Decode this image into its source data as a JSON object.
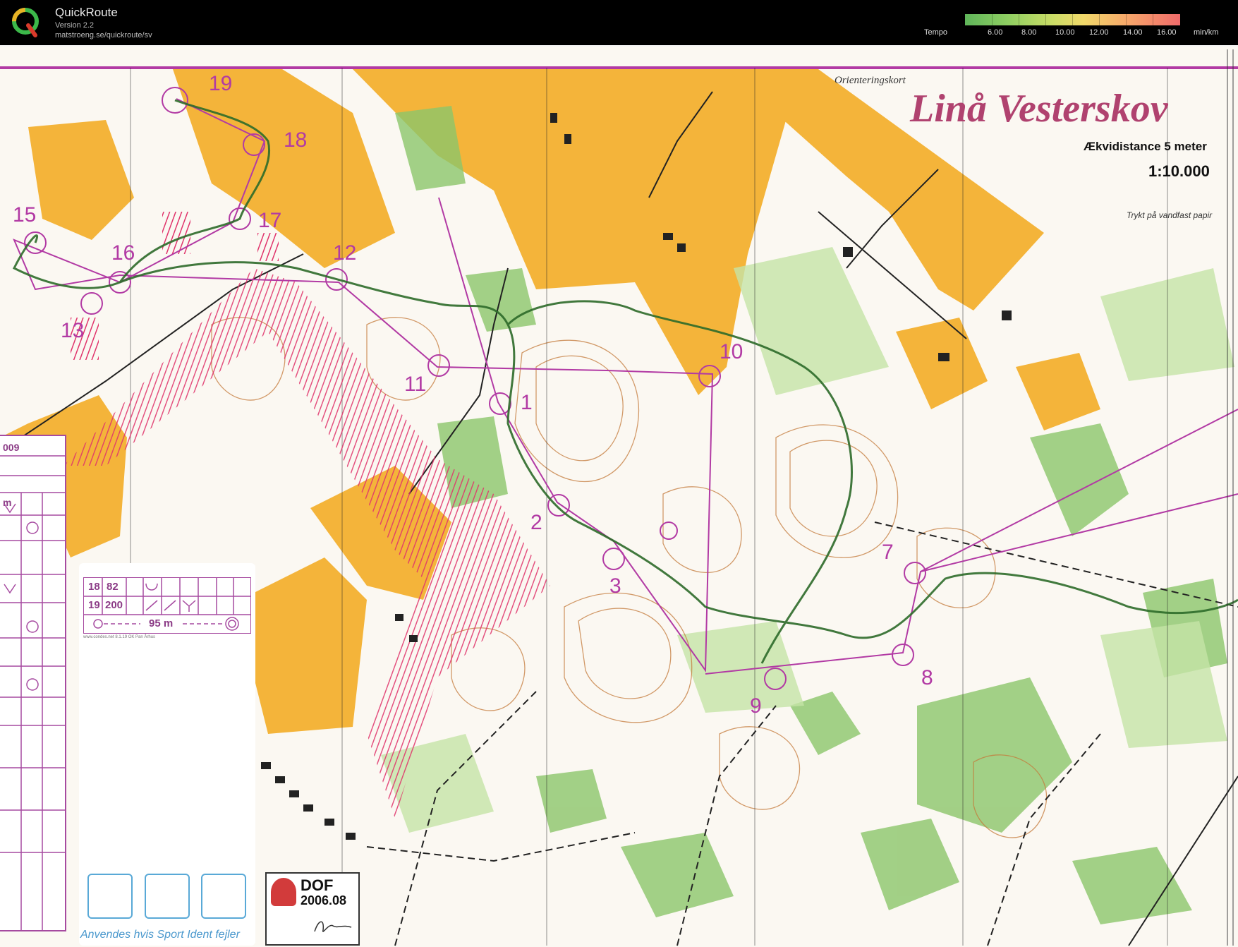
{
  "app": {
    "name": "QuickRoute",
    "version": "Version 2.2",
    "url": "matstroeng.se/quickroute/sv"
  },
  "legend": {
    "label": "Tempo",
    "ticks": [
      "6.00",
      "8.00",
      "10.00",
      "12.00",
      "14.00",
      "16.00"
    ],
    "unit": "min/km",
    "colors": [
      "#5fb55a",
      "#8fce62",
      "#c8dc66",
      "#f1d96a",
      "#f6a86a",
      "#ef6a6a"
    ]
  },
  "map": {
    "kind": "Orienteringskort",
    "title": "Linå Vesterskov",
    "equidistance": "Ækvidistance 5 meter",
    "scale": "1:10.000",
    "paper_note": "Trykt på vandfast papir",
    "colors": {
      "open_land": "#f4b43a",
      "forest_green": "#8cc56a",
      "contour": "#c47a3a",
      "course": "#b23aa4",
      "route": "#2d6b2a",
      "forbidden": "#e0336b"
    },
    "controls": [
      "1",
      "2",
      "3",
      "7",
      "8",
      "9",
      "10",
      "11",
      "12",
      "13",
      "15",
      "16",
      "17",
      "18",
      "19"
    ]
  },
  "description_sheet": {
    "year": "009",
    "unit": "m"
  },
  "control_card": {
    "row1": [
      "18",
      "82"
    ],
    "row2": [
      "19",
      "200"
    ],
    "finish": "95 m",
    "small_print": "www.condes.net 8.1.19 OK Pan Århus",
    "footer": "Anvendes hvis Sport Ident fejler"
  },
  "dof": {
    "name": "DOF",
    "version": "2006.08"
  }
}
